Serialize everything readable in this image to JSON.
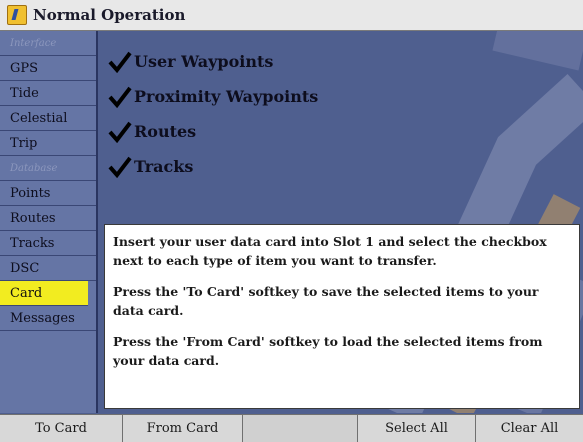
{
  "window": {
    "title": "Normal Operation"
  },
  "sidebar": {
    "items": [
      {
        "label": "Interface",
        "kind": "header"
      },
      {
        "label": "GPS"
      },
      {
        "label": "Tide"
      },
      {
        "label": "Celestial"
      },
      {
        "label": "Trip"
      },
      {
        "label": "Database",
        "kind": "header"
      },
      {
        "label": "Points"
      },
      {
        "label": "Routes"
      },
      {
        "label": "Tracks"
      },
      {
        "label": "DSC"
      },
      {
        "label": "Card",
        "selected": true
      },
      {
        "label": "Messages"
      }
    ]
  },
  "options": [
    {
      "label": "User Waypoints",
      "checked": true
    },
    {
      "label": "Proximity Waypoints",
      "checked": true
    },
    {
      "label": "Routes",
      "checked": true
    },
    {
      "label": "Tracks",
      "checked": true
    }
  ],
  "info": {
    "paragraphs": [
      "Insert your user data card into Slot 1 and select the checkbox next to each type of item you want to transfer.",
      "Press the 'To Card' softkey to save the selected items to your data card.",
      "Press the 'From Card' softkey to load the selected items from your data card."
    ]
  },
  "softkeys": {
    "to_card": "To Card",
    "from_card": "From Card",
    "select_all": "Select All",
    "clear_all": "Clear All"
  },
  "colors": {
    "background": "#4f5f8f",
    "selected": "#f2ec20",
    "sidebar": "#6575a5"
  }
}
